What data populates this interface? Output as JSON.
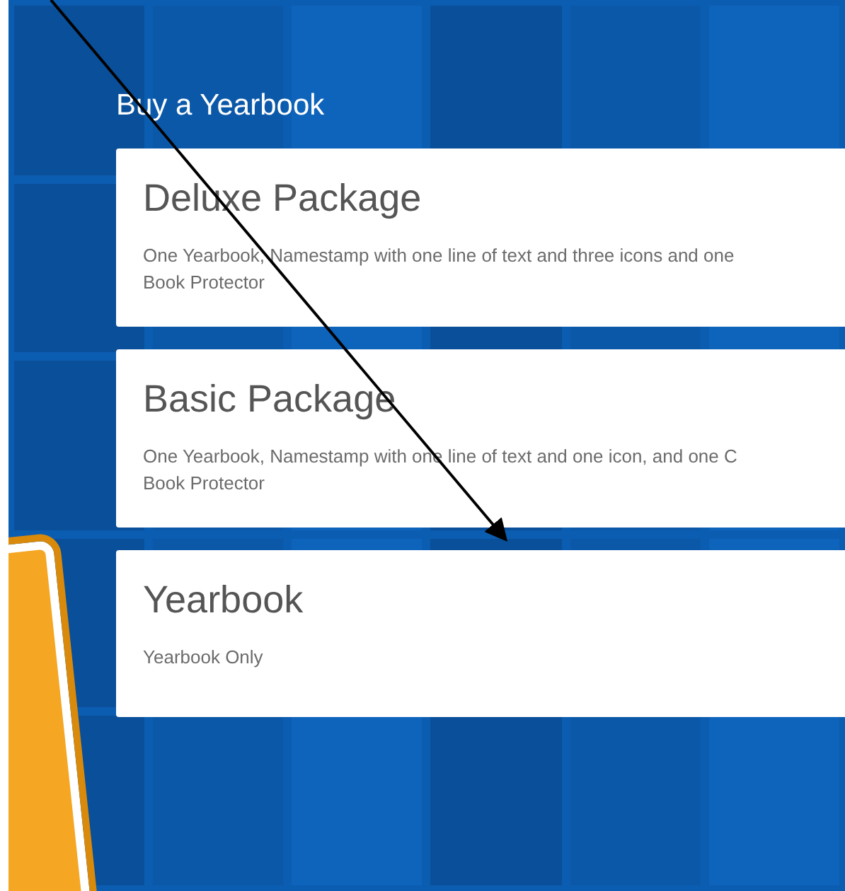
{
  "heading": "Buy a Yearbook",
  "packages": [
    {
      "title": "Deluxe Package",
      "description": [
        "One Yearbook, Namestamp with one line of text and three icons and one",
        "Book Protector"
      ]
    },
    {
      "title": "Basic Package",
      "description": [
        "One Yearbook, Namestamp with one line of text and one icon, and one C",
        "Book Protector"
      ]
    },
    {
      "title": "Yearbook",
      "description": [
        "Yearbook Only"
      ]
    }
  ]
}
